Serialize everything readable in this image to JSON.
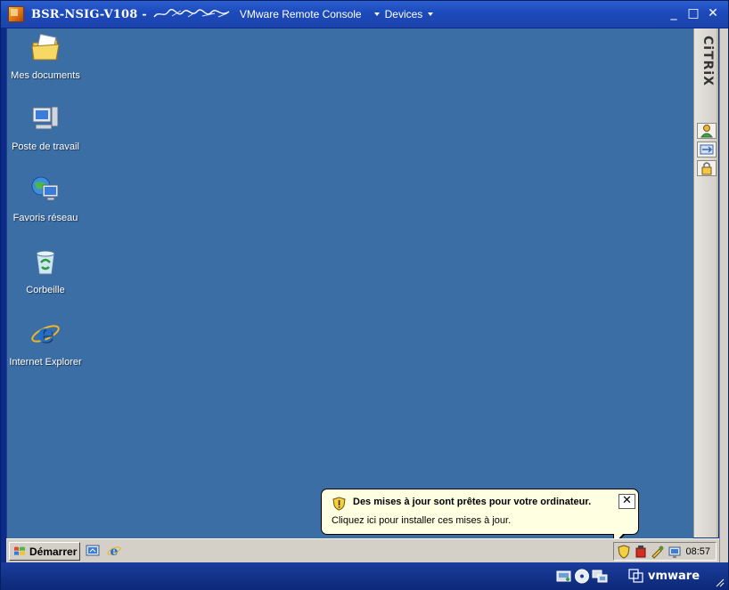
{
  "window": {
    "title": "BSR-NSIG-V108 -",
    "menus": [
      {
        "label": "VMware Remote Console"
      },
      {
        "label": "Devices"
      }
    ],
    "controls": {
      "minimize": "_",
      "maximize": "□",
      "close": "✕"
    }
  },
  "desktop": {
    "icons": [
      {
        "label": "Mes documents",
        "icon": "my-documents-icon"
      },
      {
        "label": "Poste de travail",
        "icon": "my-computer-icon"
      },
      {
        "label": "Favoris réseau",
        "icon": "network-places-icon"
      },
      {
        "label": "Corbeille",
        "icon": "recycle-bin-icon"
      },
      {
        "label": "Internet Explorer",
        "icon": "internet-explorer-icon"
      }
    ],
    "background": "#3a6ea5"
  },
  "citrix": {
    "logo": "CiTRiX",
    "buttons": [
      "citrix-user-icon",
      "citrix-transfer-icon",
      "citrix-lock-icon"
    ]
  },
  "taskbar": {
    "start_label": "Démarrer",
    "quick_launch": [
      "show-desktop-icon",
      "internet-explorer-icon"
    ],
    "tray": [
      "windows-update-shield-icon",
      "security-alert-icon",
      "tools-icon",
      "network-icon"
    ],
    "clock": "08:57"
  },
  "balloon": {
    "title": "Des mises à jour sont prêtes pour votre ordinateur.",
    "text": "Cliquez ici pour installer ces mises à jour.",
    "close": "✕"
  },
  "statusbar": {
    "brand": "vmware",
    "icons": [
      "removable-devices-icon",
      "cd-drive-icon",
      "network-adapter-icon"
    ]
  }
}
